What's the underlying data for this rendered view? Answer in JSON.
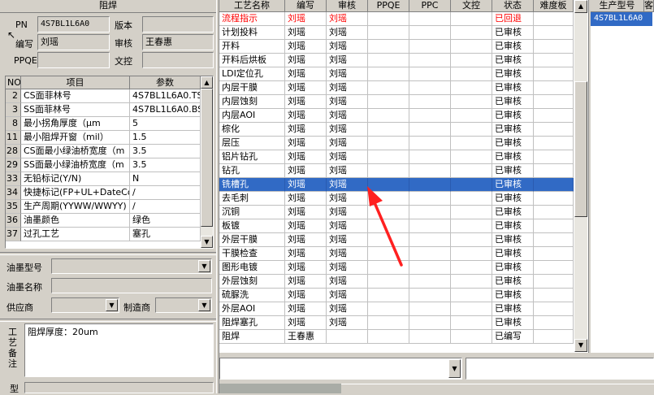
{
  "left": {
    "section_title": "阻焊",
    "pn_label": "PN",
    "pn_value": "4S7BL1L6A0",
    "version_label": "版本",
    "version_value": "",
    "author_label": "编写",
    "author_value": "刘瑶",
    "reviewer_label": "审核",
    "reviewer_value": "王春惠",
    "ppqe_label": "PPQE",
    "ppqe_value": "",
    "doc_control_label": "文控",
    "doc_control_value": "",
    "param_table": {
      "headers": [
        "NO",
        "项目",
        "参数"
      ],
      "rows": [
        {
          "no": "2",
          "item": "CS面菲林号",
          "param": "4S7BL1L6A0.TS"
        },
        {
          "no": "3",
          "item": "SS面菲林号",
          "param": "4S7BL1L6A0.BS"
        },
        {
          "no": "8",
          "item": "最小拐角厚度（μm",
          "param": "5"
        },
        {
          "no": "11",
          "item": "最小阻焊开窗（mil）",
          "param": "1.5"
        },
        {
          "no": "28",
          "item": "CS面最小绿油桥宽度（m",
          "param": "3.5"
        },
        {
          "no": "29",
          "item": "SS面最小绿油桥宽度（m",
          "param": "3.5"
        },
        {
          "no": "33",
          "item": "无铅标记(Y/N)",
          "param": "N"
        },
        {
          "no": "34",
          "item": "快捷标记(FP+UL+DateCo",
          "param": "/"
        },
        {
          "no": "35",
          "item": "生产周期(YYWW/WWYY)",
          "param": "/"
        },
        {
          "no": "36",
          "item": "油墨颜色",
          "param": "绿色"
        },
        {
          "no": "37",
          "item": "过孔工艺",
          "param": "塞孔"
        }
      ]
    },
    "ink_model_label": "油墨型号",
    "ink_model_value": "",
    "ink_name_label": "油墨名称",
    "ink_name_value": "",
    "supplier_label": "供应商",
    "supplier_value": "",
    "manufacturer_label": "制造商",
    "manufacturer_value": "",
    "remark_label": "工艺备注",
    "remark_value": "阻焊厚度：20um",
    "type_label": "型"
  },
  "process_table": {
    "headers": [
      "工艺名称",
      "编写",
      "审核",
      "PPQE",
      "PPC",
      "文控",
      "状态",
      "难度板"
    ],
    "rows": [
      {
        "name": "流程指示",
        "author": "刘瑶",
        "reviewer": "刘瑶",
        "ppqe": "",
        "ppc": "",
        "doc": "",
        "status": "已回退",
        "difficulty": "",
        "red": true,
        "selected": false
      },
      {
        "name": "计划投料",
        "author": "刘瑶",
        "reviewer": "刘瑶",
        "ppqe": "",
        "ppc": "",
        "doc": "",
        "status": "已审核",
        "difficulty": "",
        "red": false,
        "selected": false
      },
      {
        "name": "开料",
        "author": "刘瑶",
        "reviewer": "刘瑶",
        "ppqe": "",
        "ppc": "",
        "doc": "",
        "status": "已审核",
        "difficulty": "",
        "red": false,
        "selected": false
      },
      {
        "name": "开料后烘板",
        "author": "刘瑶",
        "reviewer": "刘瑶",
        "ppqe": "",
        "ppc": "",
        "doc": "",
        "status": "已审核",
        "difficulty": "",
        "red": false,
        "selected": false
      },
      {
        "name": "LDI定位孔",
        "author": "刘瑶",
        "reviewer": "刘瑶",
        "ppqe": "",
        "ppc": "",
        "doc": "",
        "status": "已审核",
        "difficulty": "",
        "red": false,
        "selected": false
      },
      {
        "name": "内层干膜",
        "author": "刘瑶",
        "reviewer": "刘瑶",
        "ppqe": "",
        "ppc": "",
        "doc": "",
        "status": "已审核",
        "difficulty": "",
        "red": false,
        "selected": false
      },
      {
        "name": "内层蚀刻",
        "author": "刘瑶",
        "reviewer": "刘瑶",
        "ppqe": "",
        "ppc": "",
        "doc": "",
        "status": "已审核",
        "difficulty": "",
        "red": false,
        "selected": false
      },
      {
        "name": "内层AOI",
        "author": "刘瑶",
        "reviewer": "刘瑶",
        "ppqe": "",
        "ppc": "",
        "doc": "",
        "status": "已审核",
        "difficulty": "",
        "red": false,
        "selected": false
      },
      {
        "name": "棕化",
        "author": "刘瑶",
        "reviewer": "刘瑶",
        "ppqe": "",
        "ppc": "",
        "doc": "",
        "status": "已审核",
        "difficulty": "",
        "red": false,
        "selected": false
      },
      {
        "name": "层压",
        "author": "刘瑶",
        "reviewer": "刘瑶",
        "ppqe": "",
        "ppc": "",
        "doc": "",
        "status": "已审核",
        "difficulty": "",
        "red": false,
        "selected": false
      },
      {
        "name": "铝片钻孔",
        "author": "刘瑶",
        "reviewer": "刘瑶",
        "ppqe": "",
        "ppc": "",
        "doc": "",
        "status": "已审核",
        "difficulty": "",
        "red": false,
        "selected": false
      },
      {
        "name": "钻孔",
        "author": "刘瑶",
        "reviewer": "刘瑶",
        "ppqe": "",
        "ppc": "",
        "doc": "",
        "status": "已审核",
        "difficulty": "",
        "red": false,
        "selected": false
      },
      {
        "name": "铣槽孔",
        "author": "刘瑶",
        "reviewer": "刘瑶",
        "ppqe": "",
        "ppc": "",
        "doc": "",
        "status": "已审核",
        "difficulty": "",
        "red": false,
        "selected": true
      },
      {
        "name": "去毛刺",
        "author": "刘瑶",
        "reviewer": "刘瑶",
        "ppqe": "",
        "ppc": "",
        "doc": "",
        "status": "已审核",
        "difficulty": "",
        "red": false,
        "selected": false
      },
      {
        "name": "沉铜",
        "author": "刘瑶",
        "reviewer": "刘瑶",
        "ppqe": "",
        "ppc": "",
        "doc": "",
        "status": "已审核",
        "difficulty": "",
        "red": false,
        "selected": false
      },
      {
        "name": "板镀",
        "author": "刘瑶",
        "reviewer": "刘瑶",
        "ppqe": "",
        "ppc": "",
        "doc": "",
        "status": "已审核",
        "difficulty": "",
        "red": false,
        "selected": false
      },
      {
        "name": "外层干膜",
        "author": "刘瑶",
        "reviewer": "刘瑶",
        "ppqe": "",
        "ppc": "",
        "doc": "",
        "status": "已审核",
        "difficulty": "",
        "red": false,
        "selected": false
      },
      {
        "name": "干膜检查",
        "author": "刘瑶",
        "reviewer": "刘瑶",
        "ppqe": "",
        "ppc": "",
        "doc": "",
        "status": "已审核",
        "difficulty": "",
        "red": false,
        "selected": false
      },
      {
        "name": "图形电镀",
        "author": "刘瑶",
        "reviewer": "刘瑶",
        "ppqe": "",
        "ppc": "",
        "doc": "",
        "status": "已审核",
        "difficulty": "",
        "red": false,
        "selected": false
      },
      {
        "name": "外层蚀刻",
        "author": "刘瑶",
        "reviewer": "刘瑶",
        "ppqe": "",
        "ppc": "",
        "doc": "",
        "status": "已审核",
        "difficulty": "",
        "red": false,
        "selected": false
      },
      {
        "name": "硫脲洗",
        "author": "刘瑶",
        "reviewer": "刘瑶",
        "ppqe": "",
        "ppc": "",
        "doc": "",
        "status": "已审核",
        "difficulty": "",
        "red": false,
        "selected": false
      },
      {
        "name": "外层AOI",
        "author": "刘瑶",
        "reviewer": "刘瑶",
        "ppqe": "",
        "ppc": "",
        "doc": "",
        "status": "已审核",
        "difficulty": "",
        "red": false,
        "selected": false
      },
      {
        "name": "阻焊塞孔",
        "author": "刘瑶",
        "reviewer": "刘瑶",
        "ppqe": "",
        "ppc": "",
        "doc": "",
        "status": "已审核",
        "difficulty": "",
        "red": false,
        "selected": false
      },
      {
        "name": "阻焊",
        "author": "王春惠",
        "reviewer": "",
        "ppqe": "",
        "ppc": "",
        "doc": "",
        "status": "已编写",
        "difficulty": "",
        "red": false,
        "selected": false
      }
    ]
  },
  "right_panel": {
    "header": "生产型号",
    "header2": "客",
    "rows": [
      {
        "model": "4S7BL1L6A0",
        "selected": true
      }
    ]
  },
  "colors": {
    "selection": "#316ac5",
    "red_text": "#ff0000",
    "annotation_arrow": "#ff2020"
  },
  "icons": {
    "scroll_up": "triangle-up",
    "scroll_down": "triangle-down",
    "dropdown": "triangle-down"
  }
}
